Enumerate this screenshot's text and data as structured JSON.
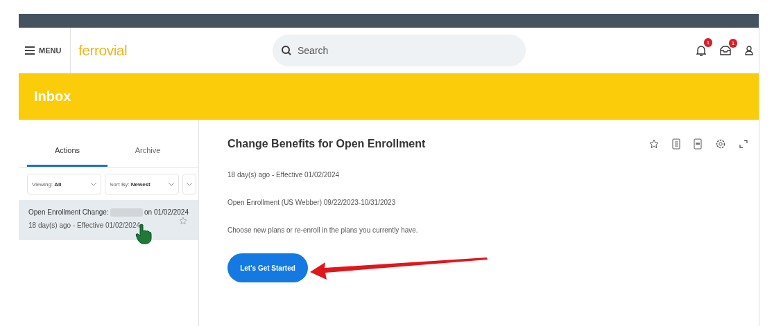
{
  "header": {
    "menu_label": "MENU",
    "logo": "ferrovial",
    "search": {
      "placeholder": "Search"
    },
    "notifications_badge": "1",
    "inbox_badge": "1"
  },
  "banner": {
    "title": "Inbox"
  },
  "tabs": [
    {
      "label": "Actions",
      "selected": true
    },
    {
      "label": "Archive",
      "selected": false
    }
  ],
  "filters": [
    {
      "label": "Viewing:",
      "value": "All"
    },
    {
      "label": "Sort By:",
      "value": "Newest"
    }
  ],
  "inbox_items": [
    {
      "title_start": "Open Enrollment Change:",
      "title_end": "on 01/02/2024",
      "subtitle": "18 day(s) ago - Effective 01/02/2024",
      "selected": true
    }
  ],
  "detail": {
    "title": "Change Benefits for Open Enrollment",
    "meta": "18 day(s) ago -  Effective 01/02/2024",
    "period": "Open Enrollment (US Webber) 09/22/2023-10/31/2023",
    "instruction": "Choose new plans or re-enroll in the plans you currently have.",
    "button": "Let's Get Started"
  }
}
